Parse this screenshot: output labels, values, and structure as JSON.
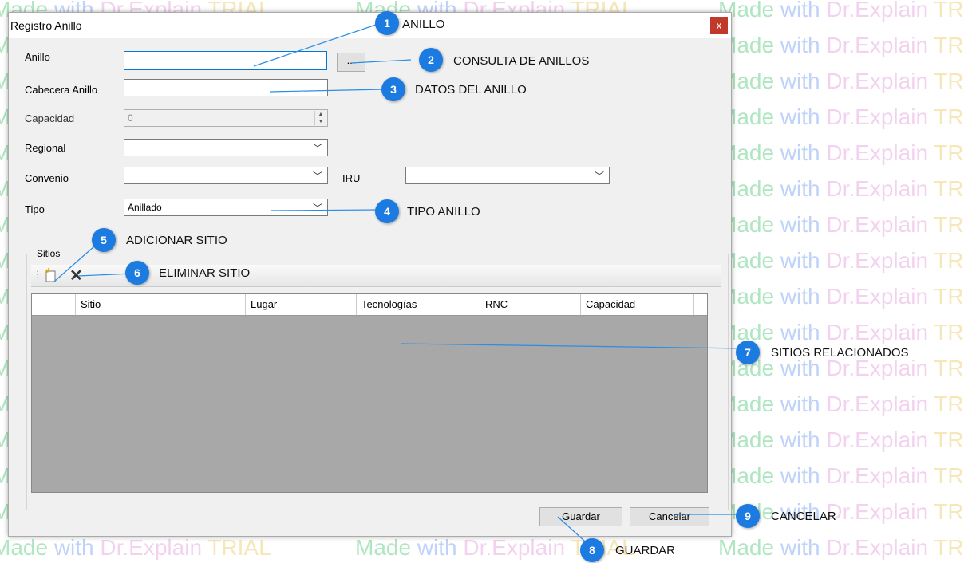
{
  "watermark": {
    "w1": "Made",
    "w2": "with",
    "w3": "Dr.Explain",
    "w4": "TRIAL"
  },
  "dialog": {
    "title": "Registro Anillo",
    "close_glyph": "x",
    "fields": {
      "anillo_label": "Anillo",
      "browse_label": "...",
      "cabecera_label": "Cabecera Anillo",
      "capacidad_label": "Capacidad",
      "capacidad_value": "0",
      "regional_label": "Regional",
      "convenio_label": "Convenio",
      "iru_label": "IRU",
      "tipo_label": "Tipo",
      "tipo_value": "Anillado"
    },
    "sitios": {
      "group_label": "Sitios",
      "add_icon": "new-item-icon",
      "delete_glyph": "✕",
      "columns": [
        "Sitio",
        "Lugar",
        "Tecnologías",
        "RNC",
        "Capacidad"
      ]
    },
    "buttons": {
      "guardar": "Guardar",
      "cancelar": "Cancelar"
    }
  },
  "annotations": [
    {
      "n": "1",
      "text": "ANILLO"
    },
    {
      "n": "2",
      "text": "CONSULTA DE ANILLOS"
    },
    {
      "n": "3",
      "text": "DATOS DEL ANILLO"
    },
    {
      "n": "4",
      "text": "TIPO ANILLO"
    },
    {
      "n": "5",
      "text": "ADICIONAR SITIO"
    },
    {
      "n": "6",
      "text": "ELIMINAR SITIO"
    },
    {
      "n": "7",
      "text": "SITIOS RELACIONADOS"
    },
    {
      "n": "8",
      "text": "GUARDAR"
    },
    {
      "n": "9",
      "text": "CANCELAR"
    }
  ],
  "colors": {
    "badge": "#1c7be0",
    "leader": "#2a8de6",
    "dialog_bg": "#f0f0f0",
    "grid_bg": "#a8a8a8",
    "close": "#c0392b"
  }
}
